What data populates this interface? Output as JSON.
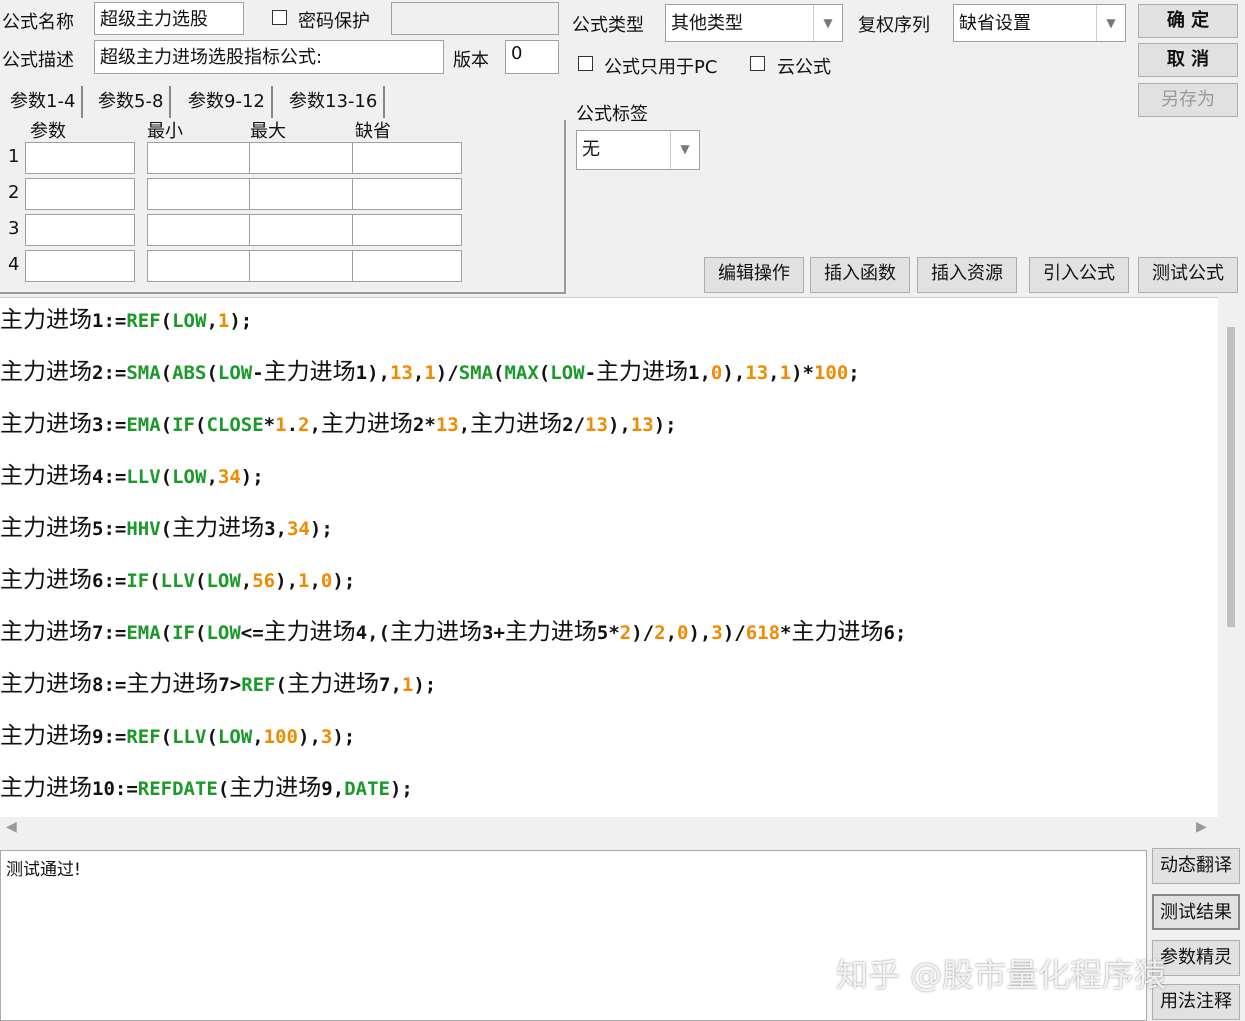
{
  "form": {
    "name_label": "公式名称",
    "name_value": "超级主力选股",
    "password_label": "密码保护",
    "desc_label": "公式描述",
    "desc_value": "超级主力进场选股指标公式:",
    "version_label": "版本",
    "version_value": "0",
    "type_label": "公式类型",
    "type_value": "其他类型",
    "rights_label": "复权序列",
    "rights_value": "缺省设置",
    "pc_only_label": "公式只用于PC",
    "cloud_label": "云公式",
    "tag_label": "公式标签",
    "tag_value": "无"
  },
  "buttons": {
    "ok": "确 定",
    "cancel": "取 消",
    "save_as": "另存为",
    "edit_op": "编辑操作",
    "insert_func": "插入函数",
    "insert_res": "插入资源",
    "import": "引入公式",
    "test": "测试公式"
  },
  "tabs": [
    "参数1-4",
    "参数5-8",
    "参数9-12",
    "参数13-16"
  ],
  "params": {
    "headers": [
      "参数",
      "最小",
      "最大",
      "缺省"
    ],
    "rows": [
      "1",
      "2",
      "3",
      "4"
    ]
  },
  "code": [
    [
      [
        "n",
        "主力进场"
      ],
      [
        "p",
        "1:="
      ],
      [
        "f",
        "REF"
      ],
      [
        "p",
        "("
      ],
      [
        "f",
        "LOW"
      ],
      [
        "p",
        ","
      ],
      [
        "num",
        "1"
      ],
      [
        "p",
        ");"
      ]
    ],
    [
      [
        "n",
        "主力进场"
      ],
      [
        "p",
        "2:="
      ],
      [
        "f",
        "SMA"
      ],
      [
        "p",
        "("
      ],
      [
        "f",
        "ABS"
      ],
      [
        "p",
        "("
      ],
      [
        "f",
        "LOW"
      ],
      [
        "p",
        "-"
      ],
      [
        "n",
        "主力进场"
      ],
      [
        "p",
        "1),"
      ],
      [
        "num",
        "13"
      ],
      [
        "p",
        ","
      ],
      [
        "num",
        "1"
      ],
      [
        "p",
        ")/"
      ],
      [
        "f",
        "SMA"
      ],
      [
        "p",
        "("
      ],
      [
        "f",
        "MAX"
      ],
      [
        "p",
        "("
      ],
      [
        "f",
        "LOW"
      ],
      [
        "p",
        "-"
      ],
      [
        "n",
        "主力进场"
      ],
      [
        "p",
        "1,"
      ],
      [
        "num",
        "0"
      ],
      [
        "p",
        "),"
      ],
      [
        "num",
        "13"
      ],
      [
        "p",
        ","
      ],
      [
        "num",
        "1"
      ],
      [
        "p",
        ")*"
      ],
      [
        "num",
        "100"
      ],
      [
        "p",
        ";"
      ]
    ],
    [
      [
        "n",
        "主力进场"
      ],
      [
        "p",
        "3:="
      ],
      [
        "f",
        "EMA"
      ],
      [
        "p",
        "("
      ],
      [
        "f",
        "IF"
      ],
      [
        "p",
        "("
      ],
      [
        "f",
        "CLOSE"
      ],
      [
        "p",
        "*"
      ],
      [
        "num",
        "1"
      ],
      [
        "p",
        "."
      ],
      [
        "num",
        "2"
      ],
      [
        "p",
        ","
      ],
      [
        "n",
        "主力进场"
      ],
      [
        "p",
        "2*"
      ],
      [
        "num",
        "13"
      ],
      [
        "p",
        ","
      ],
      [
        "n",
        "主力进场"
      ],
      [
        "p",
        "2/"
      ],
      [
        "num",
        "13"
      ],
      [
        "p",
        "),"
      ],
      [
        "num",
        "13"
      ],
      [
        "p",
        ");"
      ]
    ],
    [
      [
        "n",
        "主力进场"
      ],
      [
        "p",
        "4:="
      ],
      [
        "f",
        "LLV"
      ],
      [
        "p",
        "("
      ],
      [
        "f",
        "LOW"
      ],
      [
        "p",
        ","
      ],
      [
        "num",
        "34"
      ],
      [
        "p",
        ");"
      ]
    ],
    [
      [
        "n",
        "主力进场"
      ],
      [
        "p",
        "5:="
      ],
      [
        "f",
        "HHV"
      ],
      [
        "p",
        "("
      ],
      [
        "n",
        "主力进场"
      ],
      [
        "p",
        "3,"
      ],
      [
        "num",
        "34"
      ],
      [
        "p",
        ");"
      ]
    ],
    [
      [
        "n",
        "主力进场"
      ],
      [
        "p",
        "6:="
      ],
      [
        "f",
        "IF"
      ],
      [
        "p",
        "("
      ],
      [
        "f",
        "LLV"
      ],
      [
        "p",
        "("
      ],
      [
        "f",
        "LOW"
      ],
      [
        "p",
        ","
      ],
      [
        "num",
        "56"
      ],
      [
        "p",
        "),"
      ],
      [
        "num",
        "1"
      ],
      [
        "p",
        ","
      ],
      [
        "num",
        "0"
      ],
      [
        "p",
        ");"
      ]
    ],
    [
      [
        "n",
        "主力进场"
      ],
      [
        "p",
        "7:="
      ],
      [
        "f",
        "EMA"
      ],
      [
        "p",
        "("
      ],
      [
        "f",
        "IF"
      ],
      [
        "p",
        "("
      ],
      [
        "f",
        "LOW"
      ],
      [
        "p",
        "<="
      ],
      [
        "n",
        "主力进场"
      ],
      [
        "p",
        "4,("
      ],
      [
        "n",
        "主力进场"
      ],
      [
        "p",
        "3+"
      ],
      [
        "n",
        "主力进场"
      ],
      [
        "p",
        "5*"
      ],
      [
        "num",
        "2"
      ],
      [
        "p",
        ")/"
      ],
      [
        "num",
        "2"
      ],
      [
        "p",
        ","
      ],
      [
        "num",
        "0"
      ],
      [
        "p",
        "),"
      ],
      [
        "num",
        "3"
      ],
      [
        "p",
        ")/"
      ],
      [
        "num",
        "618"
      ],
      [
        "p",
        "*"
      ],
      [
        "n",
        "主力进场"
      ],
      [
        "p",
        "6;"
      ]
    ],
    [
      [
        "n",
        "主力进场"
      ],
      [
        "p",
        "8:="
      ],
      [
        "n",
        "主力进场"
      ],
      [
        "p",
        "7>"
      ],
      [
        "f",
        "REF"
      ],
      [
        "p",
        "("
      ],
      [
        "n",
        "主力进场"
      ],
      [
        "p",
        "7,"
      ],
      [
        "num",
        "1"
      ],
      [
        "p",
        ");"
      ]
    ],
    [
      [
        "n",
        "主力进场"
      ],
      [
        "p",
        "9:="
      ],
      [
        "f",
        "REF"
      ],
      [
        "p",
        "("
      ],
      [
        "f",
        "LLV"
      ],
      [
        "p",
        "("
      ],
      [
        "f",
        "LOW"
      ],
      [
        "p",
        ","
      ],
      [
        "num",
        "100"
      ],
      [
        "p",
        "),"
      ],
      [
        "num",
        "3"
      ],
      [
        "p",
        ");"
      ]
    ],
    [
      [
        "n",
        "主力进场"
      ],
      [
        "p",
        "10:="
      ],
      [
        "f",
        "REFDATE"
      ],
      [
        "p",
        "("
      ],
      [
        "n",
        "主力进场"
      ],
      [
        "p",
        "9,"
      ],
      [
        "f",
        "DATE"
      ],
      [
        "p",
        ");"
      ]
    ]
  ],
  "result_text": "测试通过!",
  "side_buttons": [
    "动态翻译",
    "测试结果",
    "参数精灵",
    "用法注释"
  ],
  "watermark": "知乎 @股市量化程序猿"
}
